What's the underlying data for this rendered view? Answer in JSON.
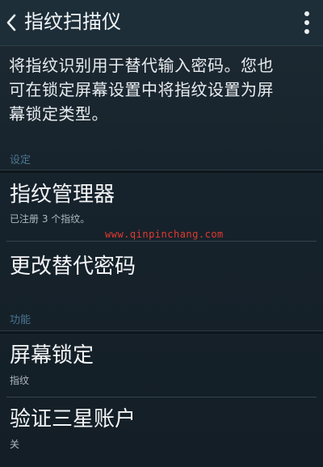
{
  "header": {
    "title": "指纹扫描仪",
    "back_icon": "chevron-left-icon",
    "menu_icon": "overflow-vertical-icon"
  },
  "description": {
    "lines": [
      "将指纹识别用于替代输入密码。您也",
      "可在锁定屏幕设置中将指纹设置为屏",
      "幕锁定类型。"
    ]
  },
  "sections": [
    {
      "header": "设定",
      "items": [
        {
          "title": "指纹管理器",
          "subtitle": "已注册 3 个指纹。"
        },
        {
          "title": "更改替代密码",
          "subtitle": ""
        }
      ]
    },
    {
      "header": "功能",
      "items": [
        {
          "title": "屏幕锁定",
          "subtitle": "指纹"
        },
        {
          "title": "验证三星账户",
          "subtitle": "关"
        }
      ]
    }
  ],
  "watermark": "www.qinpinchang.com",
  "colors": {
    "background": "#17232c",
    "action_bar": "#1d2e38",
    "section_header": "#4b7591",
    "watermark": "#e23a2f"
  }
}
